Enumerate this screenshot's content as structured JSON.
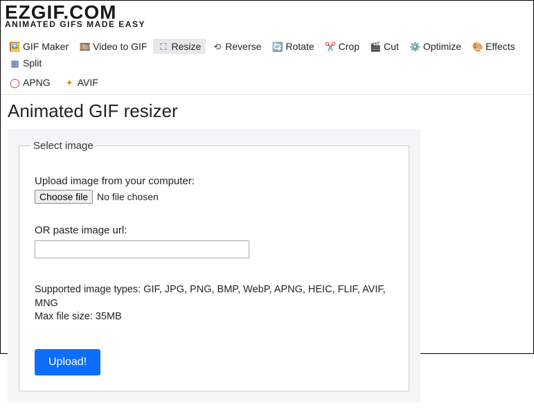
{
  "logo": {
    "main": "EZGIF.COM",
    "sub": "ANIMATED GIFS MADE EASY"
  },
  "nav": {
    "row1": [
      {
        "icon": "🖼️",
        "label": "GIF Maker",
        "color": "#d4a017"
      },
      {
        "icon": "🎞️",
        "label": "Video to GIF",
        "color": "#2a5fbd"
      },
      {
        "icon": "⛶",
        "label": "Resize",
        "color": "#2a5fbd",
        "active": true
      },
      {
        "icon": "⟲",
        "label": "Reverse",
        "color": "#444"
      },
      {
        "icon": "🔄",
        "label": "Rotate",
        "color": "#2a5fbd"
      },
      {
        "icon": "✂️",
        "label": "Crop",
        "color": "#b58a2e"
      },
      {
        "icon": "🎬",
        "label": "Cut",
        "color": "#3a5a9a"
      },
      {
        "icon": "⚙️",
        "label": "Optimize",
        "color": "#555"
      },
      {
        "icon": "🎨",
        "label": "Effects",
        "color": "#c97a2a"
      },
      {
        "icon": "▦",
        "label": "Split",
        "color": "#3a5a9a"
      }
    ],
    "row2": [
      {
        "icon": "◯",
        "label": "APNG",
        "color": "#d62020"
      },
      {
        "icon": "✦",
        "label": "AVIF",
        "color": "#d98a1a"
      }
    ]
  },
  "page": {
    "title": "Animated GIF resizer",
    "fieldset_legend": "Select image",
    "upload_label": "Upload image from your computer:",
    "choose_file": "Choose file",
    "no_file": "No file chosen",
    "or_label": "OR paste image url:",
    "url_value": "",
    "supported": "Supported image types: GIF, JPG, PNG, BMP, WebP, APNG, HEIC, FLIF, AVIF, MNG",
    "max_size": "Max file size: 35MB",
    "upload_button": "Upload!"
  }
}
